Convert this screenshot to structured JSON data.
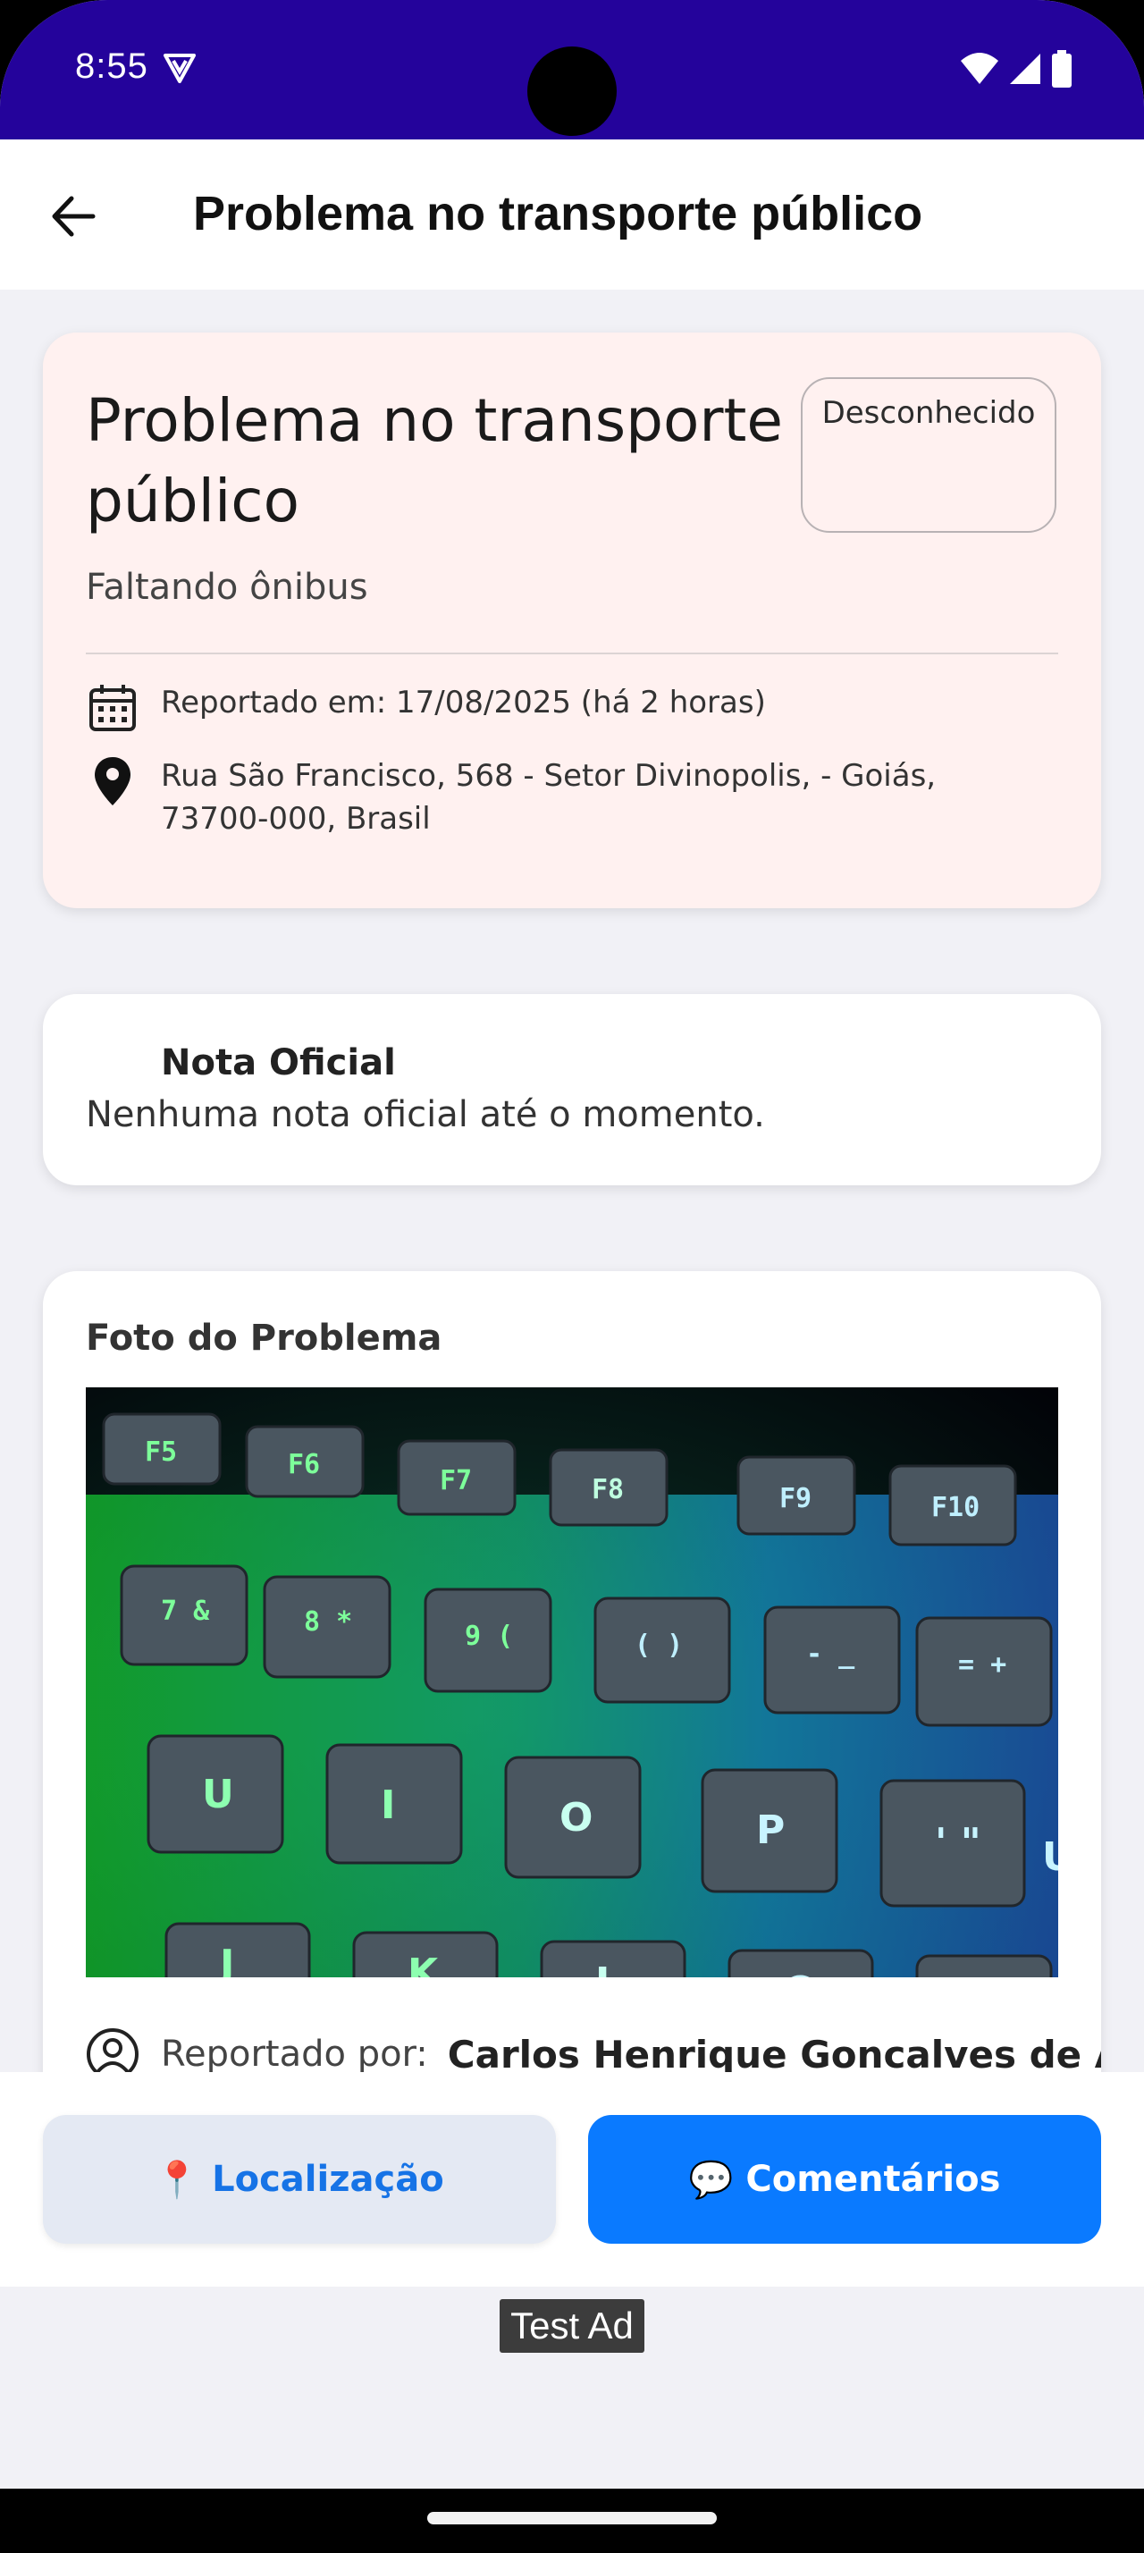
{
  "status_bar": {
    "time": "8:55",
    "vpn_icon": "shield-v-icon",
    "icons": [
      "wifi-icon",
      "signal-icon",
      "battery-icon"
    ],
    "color": "#24039b"
  },
  "app_bar": {
    "back_icon": "arrow-back-icon",
    "title": "Problema no transporte público"
  },
  "report": {
    "title": "Problema no transporte público",
    "status": "Desconhecido",
    "category": "Faltando ônibus",
    "reported_at": "Reportado em: 17/08/2025 (há 2 horas)",
    "address": "Rua São Francisco, 568 - Setor Divinopolis,  - Goiás, 73700-000, Brasil",
    "card_color": "#fff1f0"
  },
  "note": {
    "title": "Nota Oficial",
    "text": "Nenhuma nota oficial até o momento."
  },
  "photo": {
    "title": "Foto do Problema",
    "keys_row1": [
      "F5",
      "F6",
      "F7",
      "F8",
      "F9",
      "F10"
    ],
    "keys_row2": [
      "7 &",
      "8 *",
      "9 (",
      "( )",
      "- _",
      "= +"
    ],
    "keys_row3": [
      "U",
      "I",
      "O",
      "P",
      "' \"",
      "U"
    ],
    "keys_row4": [
      "J",
      "K",
      "L",
      "Ç",
      "~ ^"
    ],
    "reporter_label": "Reportado por:",
    "reporter_name": "Carlos Henrique Goncalves de Araú"
  },
  "actions": {
    "location_emoji": "📍",
    "location_label": "Localização",
    "comments_emoji": "💬",
    "comments_label": "Comentários",
    "accent": "#0a7aff"
  },
  "ad": {
    "label": "Test Ad"
  }
}
